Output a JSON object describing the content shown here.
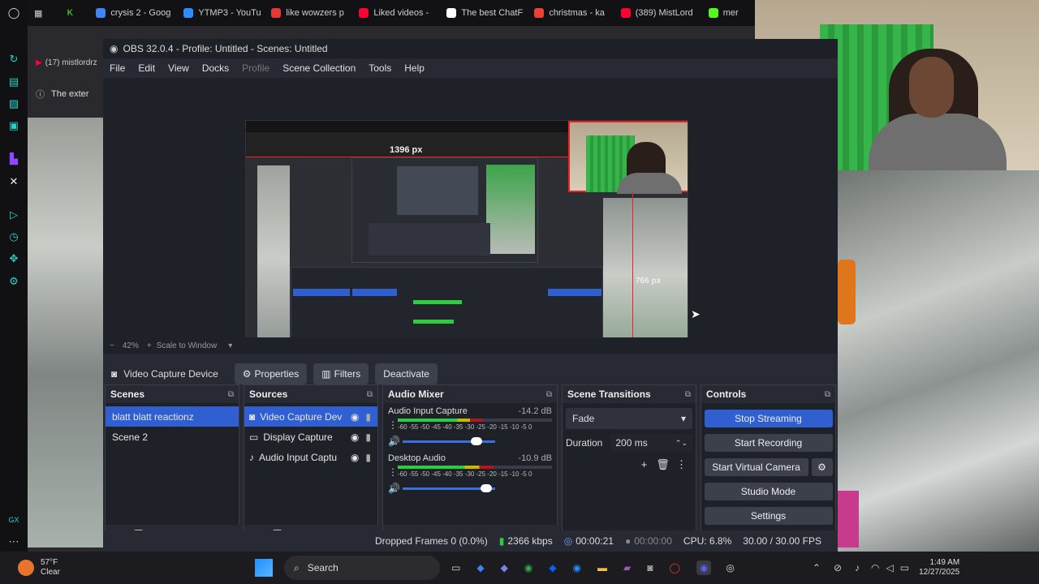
{
  "browser": {
    "tabs": [
      {
        "label": "crysis 2 - Goog",
        "color": "#4285f4"
      },
      {
        "label": "YTMP3 - YouTu",
        "color": "#2d8cff"
      },
      {
        "label": "like wowzers p",
        "color": "#e53935"
      },
      {
        "label": "Liked videos -",
        "color": "#ff0033"
      },
      {
        "label": "The best ChatF",
        "color": "#ffffff"
      },
      {
        "label": "christmas - ka",
        "color": "#ea4335"
      },
      {
        "label": "(389) MistLord",
        "color": "#ff0033"
      },
      {
        "label": "mer",
        "color": "#53fc18"
      }
    ],
    "inner_tab": "(17) mistlordrz",
    "banner_text": "The exter"
  },
  "obs": {
    "title": "OBS 32.0.4 - Profile: Untitled - Scenes: Untitled",
    "menu": [
      "File",
      "Edit",
      "View",
      "Docks",
      "Profile",
      "Scene Collection",
      "Tools",
      "Help"
    ],
    "preview": {
      "width_label": "1396 px",
      "height_label": "766 px",
      "zoom": "42%",
      "scale_mode": "Scale to Window"
    },
    "source_toolbar": {
      "selected_source": "Video Capture Device",
      "properties": "Properties",
      "filters": "Filters",
      "deactivate": "Deactivate"
    },
    "scenes": {
      "title": "Scenes",
      "items": [
        "blatt blatt reactionz",
        "Scene 2"
      ]
    },
    "sources": {
      "title": "Sources",
      "items": [
        "Video Capture Dev",
        "Display Capture",
        "Audio Input Captu"
      ]
    },
    "mixer": {
      "title": "Audio Mixer",
      "channels": [
        {
          "name": "Audio Input Capture",
          "db": "-14.2 dB",
          "level": 0.55,
          "volume": 0.8
        },
        {
          "name": "Desktop Audio",
          "db": "-10.9 dB",
          "level": 0.62,
          "volume": 0.9
        }
      ],
      "scale": "-60 -55 -50 -45 -40 -35 -30 -25 -20 -15 -10 -5 0"
    },
    "transitions": {
      "title": "Scene Transitions",
      "type": "Fade",
      "duration_label": "Duration",
      "duration": "200 ms"
    },
    "controls": {
      "title": "Controls",
      "stop_streaming": "Stop Streaming",
      "start_recording": "Start Recording",
      "start_virtual_camera": "Start Virtual Camera",
      "studio_mode": "Studio Mode",
      "settings": "Settings"
    },
    "status": {
      "dropped_frames": "Dropped Frames 0 (0.0%)",
      "bitrate": "2366 kbps",
      "stream_time": "00:00:21",
      "rec_time": "00:00:00",
      "cpu": "CPU: 6.8%",
      "fps": "30.00 / 30.00 FPS"
    }
  },
  "taskbar": {
    "weather_temp": "57°F",
    "weather_desc": "Clear",
    "search": "Search",
    "time": "1:49 AM",
    "date": "12/27/2025"
  },
  "colors": {
    "accent": "#2f5fd1",
    "meter_green": "#2ecc40",
    "meter_yellow": "#c9b800",
    "meter_red": "#b3161d"
  }
}
